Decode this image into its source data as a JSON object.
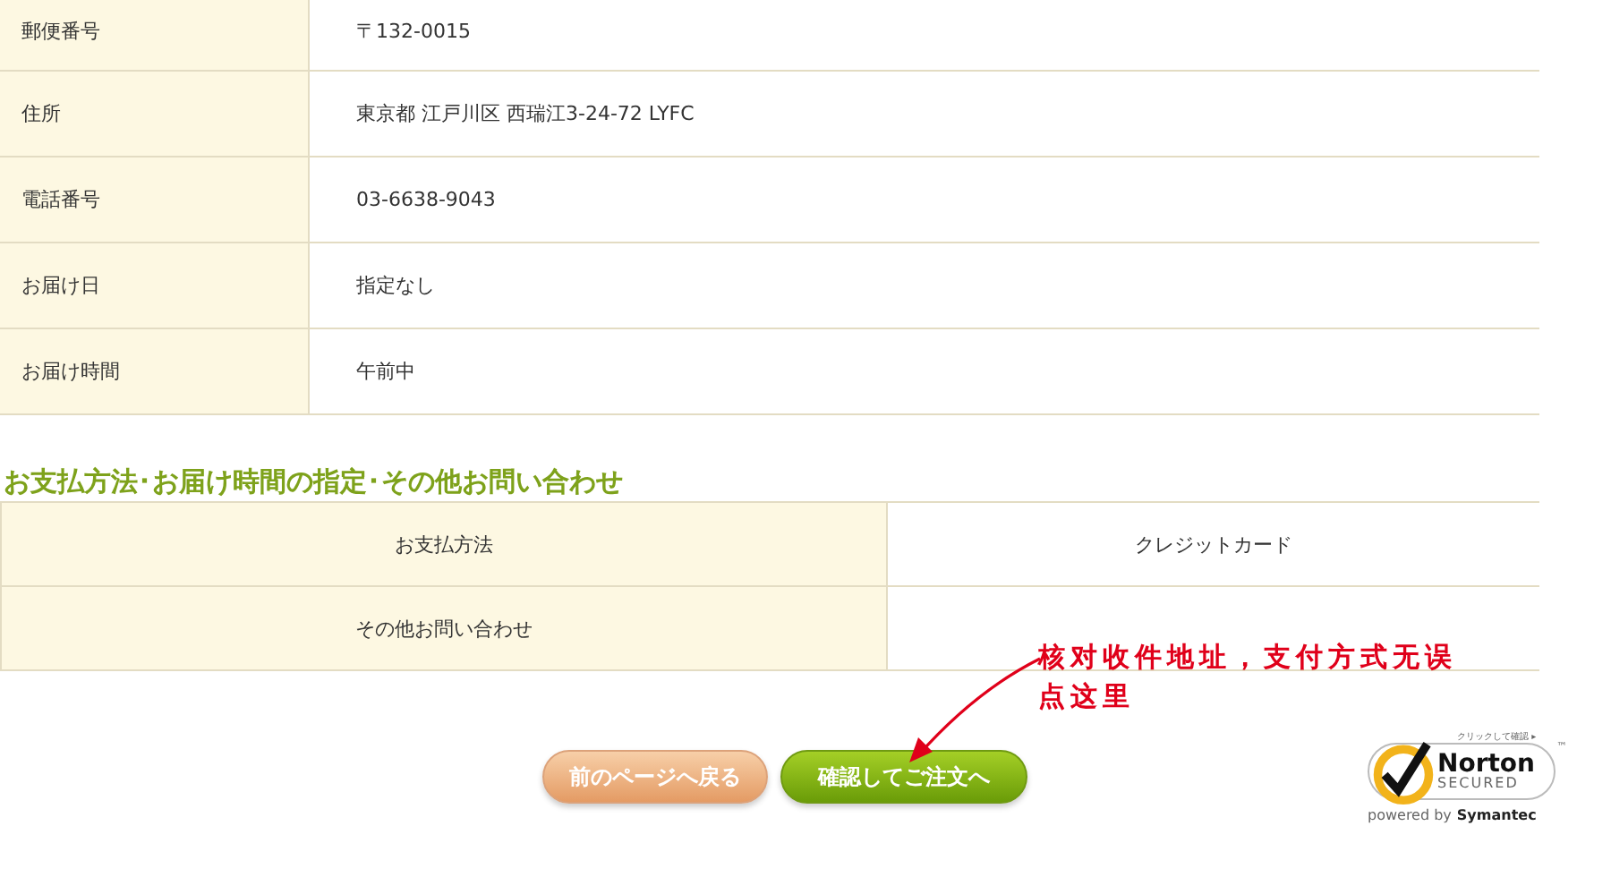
{
  "shipping_table": {
    "rows": [
      {
        "label": "郵便番号",
        "value": "〒132-0015"
      },
      {
        "label": "住所",
        "value": "東京都  江戸川区  西瑞江3-24-72  LYFC"
      },
      {
        "label": "電話番号",
        "value": "03-6638-9043"
      },
      {
        "label": "お届け日",
        "value": "指定なし"
      },
      {
        "label": "お届け時間",
        "value": "午前中"
      }
    ]
  },
  "payment_section": {
    "heading": "お支払方法･お届け時間の指定･その他お問い合わせ",
    "rows": [
      {
        "label": "お支払方法",
        "value": "クレジットカード"
      },
      {
        "label": "その他お問い合わせ"
      }
    ]
  },
  "buttons": [
    {
      "label": "前のページへ戻る",
      "kind": "back"
    },
    {
      "label": "確認してご注文へ",
      "kind": "confirm"
    }
  ],
  "annotation": {
    "lines": [
      "核对收件地址，支付方式无误",
      "点这里"
    ]
  },
  "norton_seal": {
    "caption": "クリックして確認 ▸",
    "brand": "Norton",
    "secured": "SECURED",
    "tm": "™",
    "powered_by": "powered by",
    "company": "Symantec"
  }
}
